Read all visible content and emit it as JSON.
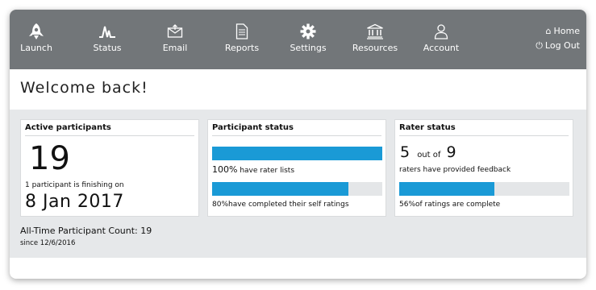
{
  "nav": {
    "items": [
      {
        "label": "Launch",
        "icon": "rocket-icon"
      },
      {
        "label": "Status",
        "icon": "pulse-icon"
      },
      {
        "label": "Email",
        "icon": "email-icon"
      },
      {
        "label": "Reports",
        "icon": "document-icon"
      },
      {
        "label": "Settings",
        "icon": "gear-icon"
      },
      {
        "label": "Resources",
        "icon": "bank-icon"
      },
      {
        "label": "Account",
        "icon": "user-icon"
      }
    ],
    "home_label": "Home",
    "logout_label": "Log Out"
  },
  "welcome": "Welcome back!",
  "cards": {
    "active": {
      "title": "Active participants",
      "count": "19",
      "finishing_text": "1 participant is finishing on",
      "date": "8 Jan 2017"
    },
    "participant": {
      "title": "Participant status",
      "bar1_percent_label": "100%",
      "bar1_text": "have rater lists",
      "bar1_value": 1.0,
      "bar2_percent_label": "80%",
      "bar2_text": "have completed their self ratings",
      "bar2_value": 0.8
    },
    "rater": {
      "title": "Rater status",
      "done": "5",
      "out_of": "out of",
      "total": "9",
      "provided_text": "raters have provided feedback",
      "percent_label": "56%",
      "percent_text": "of ratings are complete",
      "value": 0.56
    }
  },
  "footer": {
    "count_text": "All-Time Participant Count: 19",
    "since_text": "since 12/6/2016"
  },
  "colors": {
    "topbar": "#727679",
    "bar_fill": "#1a9ad6",
    "bar_track": "#e4e6e8",
    "panel_bg": "#e6e8ea"
  }
}
